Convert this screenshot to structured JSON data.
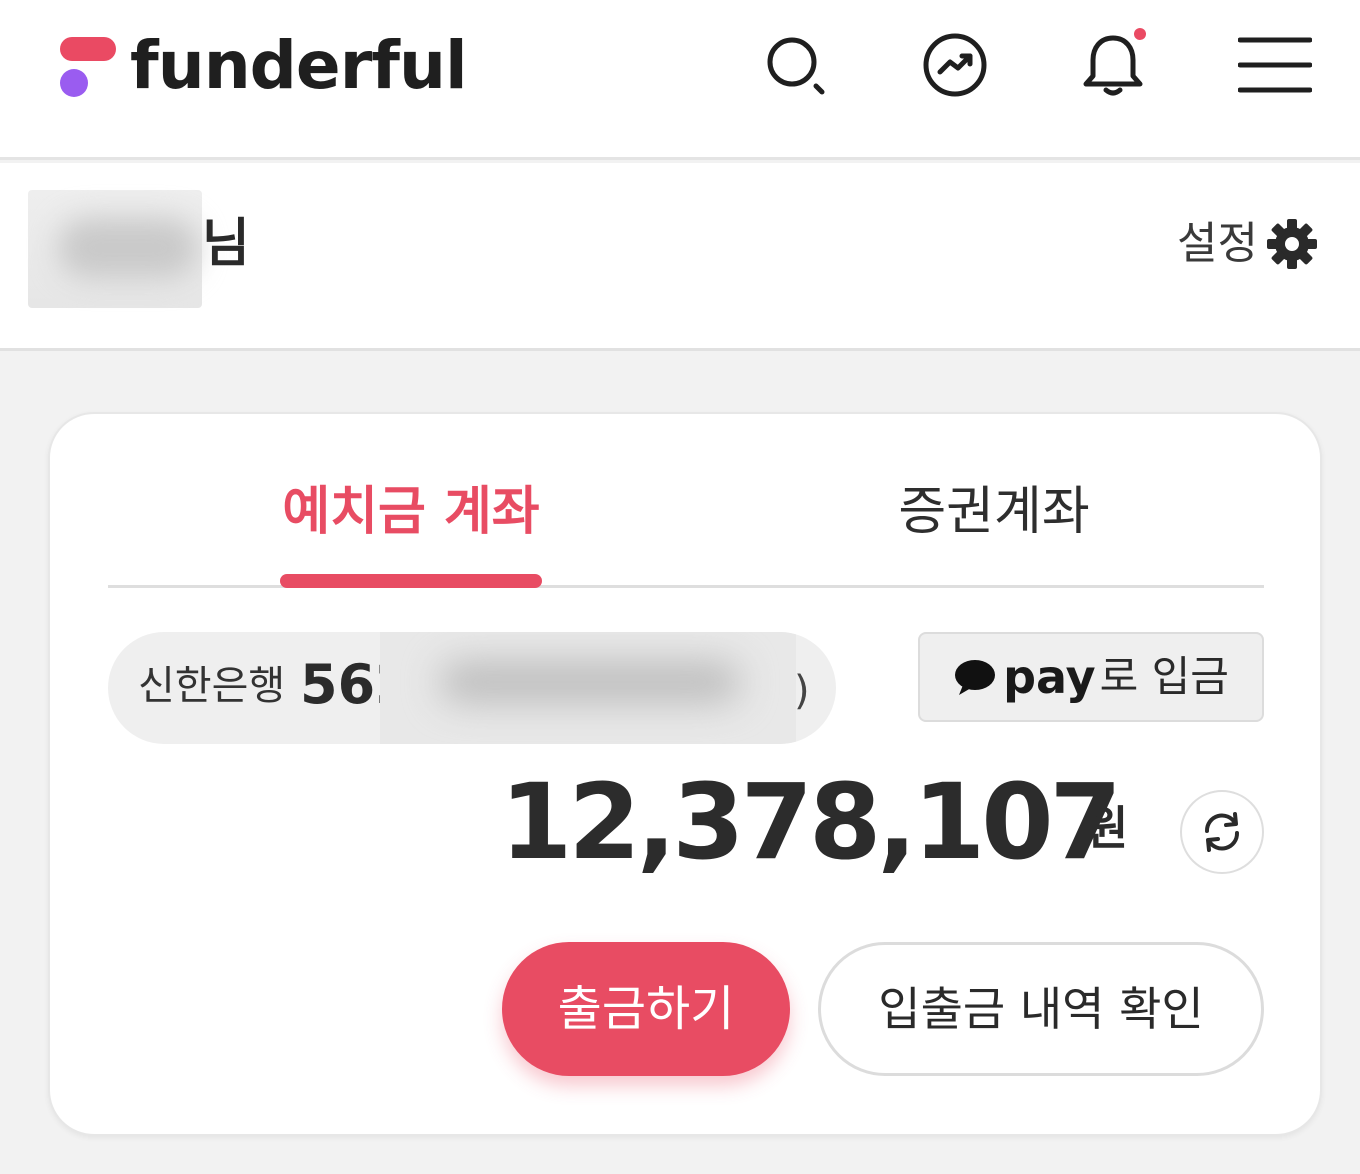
{
  "header": {
    "brand": "funderful",
    "icons": [
      "search-icon",
      "trend-icon",
      "bell-icon",
      "menu-icon"
    ],
    "has_notification": true
  },
  "user": {
    "name_suffix": "님",
    "settings_label": "설정"
  },
  "tabs": [
    {
      "label": "예치금 계좌",
      "active": true
    },
    {
      "label": "증권계좌",
      "active": false
    }
  ],
  "account": {
    "bank": "신한은행",
    "number_prefix": "562",
    "number_tail": ")"
  },
  "pay_button": {
    "brand": "pay",
    "label": "로 입금"
  },
  "balance": {
    "amount": "12,378,107",
    "currency": "원"
  },
  "actions": {
    "withdraw": "출금하기",
    "history": "입출금 내역 확인"
  },
  "colors": {
    "accent": "#e84c63",
    "logo_pink": "#ea4a63",
    "logo_purple": "#9a5cf0"
  }
}
